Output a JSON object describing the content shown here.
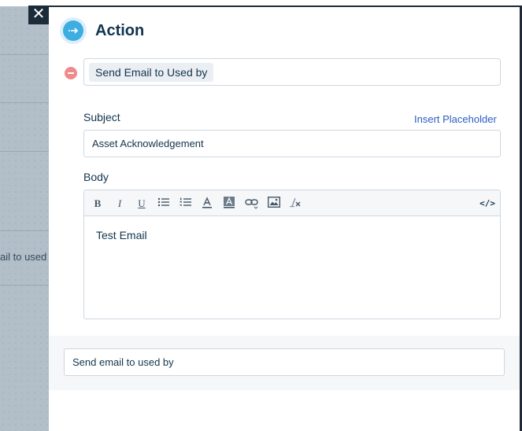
{
  "background": {
    "partial_label": "ail to used"
  },
  "close": {
    "symbol": "✕"
  },
  "header": {
    "title": "Action"
  },
  "action": {
    "selected": "Send Email to Used by"
  },
  "subject": {
    "label": "Subject",
    "insert_placeholder_link": "Insert Placeholder",
    "value": "Asset Acknowledgement"
  },
  "body": {
    "label": "Body",
    "text": "Test Email",
    "toolbar": {
      "bold": "B",
      "italic": "I",
      "underline": "U",
      "source": "</>"
    }
  },
  "footer": {
    "name_value": "Send email to used by"
  },
  "colors": {
    "accent": "#3eaee0",
    "link": "#2c5cc5",
    "remove": "#f08a8a",
    "text": "#12344d"
  }
}
